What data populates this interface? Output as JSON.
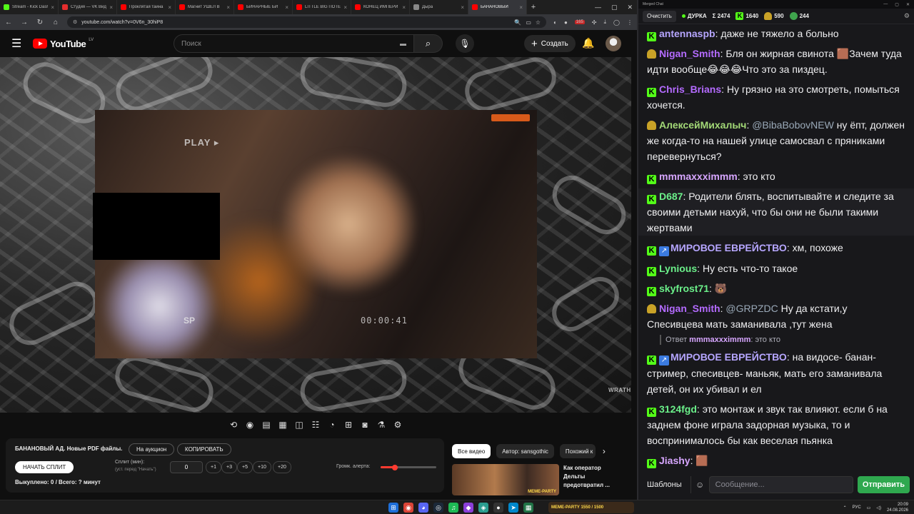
{
  "browser": {
    "tabs": [
      {
        "label": "Stream - Kick Dash",
        "color": "#53fc18",
        "active": false
      },
      {
        "label": "Студия — VK Видео",
        "color": "#e52d2d",
        "active": false
      },
      {
        "label": "Проклятая тайна",
        "color": "#ff0000",
        "active": false
      },
      {
        "label": "Магнит УШЁЛ В",
        "color": "#ff0000",
        "active": false
      },
      {
        "label": "БИНАРНЫЕ БИ",
        "color": "#ff0000",
        "active": false
      },
      {
        "label": "LITTLE BIG ПОТЕР",
        "color": "#ff0000",
        "active": false
      },
      {
        "label": "КОНЕЦ ИМПЕРИ",
        "color": "#ff0000",
        "active": false
      },
      {
        "label": "Дыра",
        "color": "#888888",
        "active": false
      },
      {
        "label": "БАНАНОВЫЙ",
        "color": "#ff0000",
        "active": true
      }
    ],
    "url": "youtube.com/watch?v=0V6n_30hiP8",
    "ext_count": "165"
  },
  "youtube": {
    "brand": "YouTube",
    "region": "LV",
    "search_placeholder": "Поиск",
    "create_label": "Создать",
    "video": {
      "play_tag": "PLAY ▸",
      "sp_tag": "SP",
      "timecode": "00:00:41",
      "watermark": "WRATH"
    },
    "panel": {
      "title": "БАНАНОВЫЙ АД. Новые PDF файлы.",
      "auction_label": "На аукцион",
      "copy_label": "КОПИРОВАТЬ",
      "start_label": "НАЧАТЬ СПЛИТ",
      "split_label": "Сплит (мин):",
      "split_sub": "(уст. перед \"Начать\")",
      "split_value": "0",
      "increments": [
        "+1",
        "+3",
        "+5",
        "+10",
        "+20"
      ],
      "alert_label": "Громк. алерта:",
      "alert_volume": 0.26,
      "bought_label": "Выкуплено: 0 / Всего: ? минут"
    },
    "related": {
      "chips": [
        "Все видео",
        "Автор: sansgothic",
        "Похожий к"
      ],
      "title": "Как оператор Дельты предотвратил ...",
      "thumb_badge": "MEME-PARTY"
    }
  },
  "chat": {
    "window_title": "Merged Chat",
    "clear_label": "Очистить",
    "channel": "ДУРКА",
    "total": "Σ 2474",
    "kick_count": "1640",
    "twitch_count": "590",
    "other_count": "244",
    "messages": [
      {
        "platform": "kick",
        "user": "antennaspb",
        "color": "#b6a6ff",
        "text": "даже не тяжело а больно"
      },
      {
        "platform": "twitch",
        "user": "Nigan_Smith",
        "color": "#b46bff",
        "text": "Бля он жирная свинота 🟫Зачем туда идти вообще😂😂😂Что это за пиздец."
      },
      {
        "platform": "kick",
        "user": "Chris_Brians",
        "color": "#b46bff",
        "text": "Ну грязно на это смотреть, помыться хочется."
      },
      {
        "platform": "twitch",
        "user": "АлексейМихалыч",
        "color": "#a3d977",
        "mention": "@BibaBobovNEW",
        "text": " ну ёпт, должен же когда-то на нашей улице самосвал с пряниками перевернуться?"
      },
      {
        "platform": "kick",
        "user": "mmmaxxximmm",
        "color": "#d7a6ff",
        "text": "это кто"
      },
      {
        "platform": "kick",
        "user": "D687",
        "color": "#6bf08a",
        "text": "Родители блять, воспитывайте и следите за своими детьми нахуй, что бы они не были такими жертвами",
        "hl": true
      },
      {
        "platform": "kick",
        "user": "МИРОВОЕ ЕВРЕЙСТВО",
        "color": "#b6a6ff",
        "text": "хм, похоже",
        "arrow": true
      },
      {
        "platform": "kick",
        "user": "Lynious",
        "color": "#6bf08a",
        "text": "Ну есть что-то такое"
      },
      {
        "platform": "kick",
        "user": "skyfrost71",
        "color": "#6bf08a",
        "text": "🐻"
      },
      {
        "platform": "twitch",
        "user": "Nigan_Smith",
        "color": "#b46bff",
        "mention": "@GRPZDC",
        "text": " Ну да кстати,у Спесивцева мать заманивала ,тут жена"
      },
      {
        "platform": "kick",
        "user": "МИРОВОЕ ЕВРЕЙСТВО",
        "color": "#b6a6ff",
        "text": "на видосе- банан-стример, спесивцев- маньяк, мать его заманивала детей, он их убивал и ел",
        "arrow": true,
        "reply": {
          "prefix": "Ответ",
          "user": "mmmaxxximmm",
          "text": ": это кто"
        }
      },
      {
        "platform": "kick",
        "user": "3124fgd",
        "color": "#6bf08a",
        "text": "это монтаж и звук так влияют. если б на заднем фоне играла задорная музыка, то и воспринималось бы как веселая пьянка"
      },
      {
        "platform": "kick",
        "user": "Jiashy",
        "color": "#d7a6ff",
        "text": "🟫"
      }
    ],
    "templates_label": "Шаблоны",
    "input_placeholder": "Сообщение...",
    "send_label": "Отправить"
  },
  "taskbar": {
    "widget_text": "MEME-PARTY 1550 / 1500",
    "lang": "РУС",
    "time": "20:09",
    "date": "24.08.2026"
  }
}
